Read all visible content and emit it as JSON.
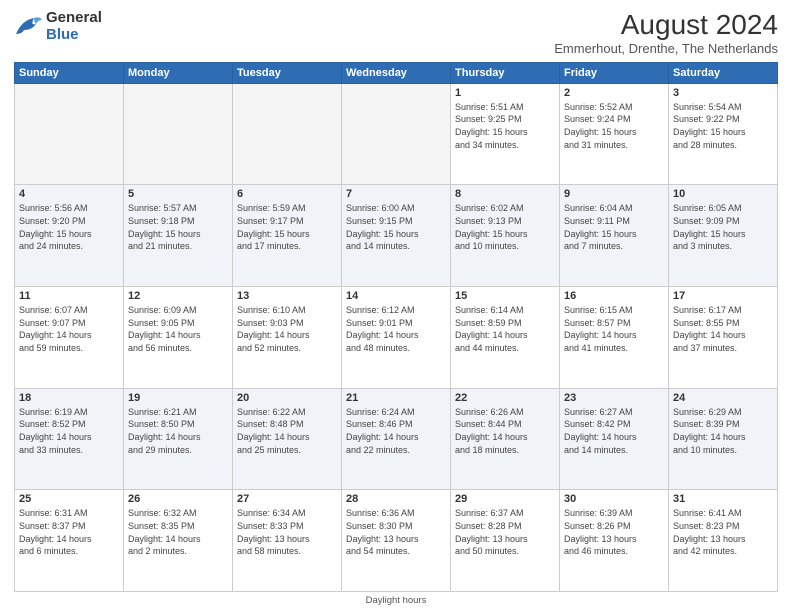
{
  "logo": {
    "general": "General",
    "blue": "Blue"
  },
  "title": {
    "month_year": "August 2024",
    "location": "Emmerhout, Drenthe, The Netherlands"
  },
  "days_of_week": [
    "Sunday",
    "Monday",
    "Tuesday",
    "Wednesday",
    "Thursday",
    "Friday",
    "Saturday"
  ],
  "footer": {
    "text": "Daylight hours"
  },
  "weeks": [
    [
      {
        "day": "",
        "info": ""
      },
      {
        "day": "",
        "info": ""
      },
      {
        "day": "",
        "info": ""
      },
      {
        "day": "",
        "info": ""
      },
      {
        "day": "1",
        "info": "Sunrise: 5:51 AM\nSunset: 9:25 PM\nDaylight: 15 hours\nand 34 minutes."
      },
      {
        "day": "2",
        "info": "Sunrise: 5:52 AM\nSunset: 9:24 PM\nDaylight: 15 hours\nand 31 minutes."
      },
      {
        "day": "3",
        "info": "Sunrise: 5:54 AM\nSunset: 9:22 PM\nDaylight: 15 hours\nand 28 minutes."
      }
    ],
    [
      {
        "day": "4",
        "info": "Sunrise: 5:56 AM\nSunset: 9:20 PM\nDaylight: 15 hours\nand 24 minutes."
      },
      {
        "day": "5",
        "info": "Sunrise: 5:57 AM\nSunset: 9:18 PM\nDaylight: 15 hours\nand 21 minutes."
      },
      {
        "day": "6",
        "info": "Sunrise: 5:59 AM\nSunset: 9:17 PM\nDaylight: 15 hours\nand 17 minutes."
      },
      {
        "day": "7",
        "info": "Sunrise: 6:00 AM\nSunset: 9:15 PM\nDaylight: 15 hours\nand 14 minutes."
      },
      {
        "day": "8",
        "info": "Sunrise: 6:02 AM\nSunset: 9:13 PM\nDaylight: 15 hours\nand 10 minutes."
      },
      {
        "day": "9",
        "info": "Sunrise: 6:04 AM\nSunset: 9:11 PM\nDaylight: 15 hours\nand 7 minutes."
      },
      {
        "day": "10",
        "info": "Sunrise: 6:05 AM\nSunset: 9:09 PM\nDaylight: 15 hours\nand 3 minutes."
      }
    ],
    [
      {
        "day": "11",
        "info": "Sunrise: 6:07 AM\nSunset: 9:07 PM\nDaylight: 14 hours\nand 59 minutes."
      },
      {
        "day": "12",
        "info": "Sunrise: 6:09 AM\nSunset: 9:05 PM\nDaylight: 14 hours\nand 56 minutes."
      },
      {
        "day": "13",
        "info": "Sunrise: 6:10 AM\nSunset: 9:03 PM\nDaylight: 14 hours\nand 52 minutes."
      },
      {
        "day": "14",
        "info": "Sunrise: 6:12 AM\nSunset: 9:01 PM\nDaylight: 14 hours\nand 48 minutes."
      },
      {
        "day": "15",
        "info": "Sunrise: 6:14 AM\nSunset: 8:59 PM\nDaylight: 14 hours\nand 44 minutes."
      },
      {
        "day": "16",
        "info": "Sunrise: 6:15 AM\nSunset: 8:57 PM\nDaylight: 14 hours\nand 41 minutes."
      },
      {
        "day": "17",
        "info": "Sunrise: 6:17 AM\nSunset: 8:55 PM\nDaylight: 14 hours\nand 37 minutes."
      }
    ],
    [
      {
        "day": "18",
        "info": "Sunrise: 6:19 AM\nSunset: 8:52 PM\nDaylight: 14 hours\nand 33 minutes."
      },
      {
        "day": "19",
        "info": "Sunrise: 6:21 AM\nSunset: 8:50 PM\nDaylight: 14 hours\nand 29 minutes."
      },
      {
        "day": "20",
        "info": "Sunrise: 6:22 AM\nSunset: 8:48 PM\nDaylight: 14 hours\nand 25 minutes."
      },
      {
        "day": "21",
        "info": "Sunrise: 6:24 AM\nSunset: 8:46 PM\nDaylight: 14 hours\nand 22 minutes."
      },
      {
        "day": "22",
        "info": "Sunrise: 6:26 AM\nSunset: 8:44 PM\nDaylight: 14 hours\nand 18 minutes."
      },
      {
        "day": "23",
        "info": "Sunrise: 6:27 AM\nSunset: 8:42 PM\nDaylight: 14 hours\nand 14 minutes."
      },
      {
        "day": "24",
        "info": "Sunrise: 6:29 AM\nSunset: 8:39 PM\nDaylight: 14 hours\nand 10 minutes."
      }
    ],
    [
      {
        "day": "25",
        "info": "Sunrise: 6:31 AM\nSunset: 8:37 PM\nDaylight: 14 hours\nand 6 minutes."
      },
      {
        "day": "26",
        "info": "Sunrise: 6:32 AM\nSunset: 8:35 PM\nDaylight: 14 hours\nand 2 minutes."
      },
      {
        "day": "27",
        "info": "Sunrise: 6:34 AM\nSunset: 8:33 PM\nDaylight: 13 hours\nand 58 minutes."
      },
      {
        "day": "28",
        "info": "Sunrise: 6:36 AM\nSunset: 8:30 PM\nDaylight: 13 hours\nand 54 minutes."
      },
      {
        "day": "29",
        "info": "Sunrise: 6:37 AM\nSunset: 8:28 PM\nDaylight: 13 hours\nand 50 minutes."
      },
      {
        "day": "30",
        "info": "Sunrise: 6:39 AM\nSunset: 8:26 PM\nDaylight: 13 hours\nand 46 minutes."
      },
      {
        "day": "31",
        "info": "Sunrise: 6:41 AM\nSunset: 8:23 PM\nDaylight: 13 hours\nand 42 minutes."
      }
    ]
  ]
}
